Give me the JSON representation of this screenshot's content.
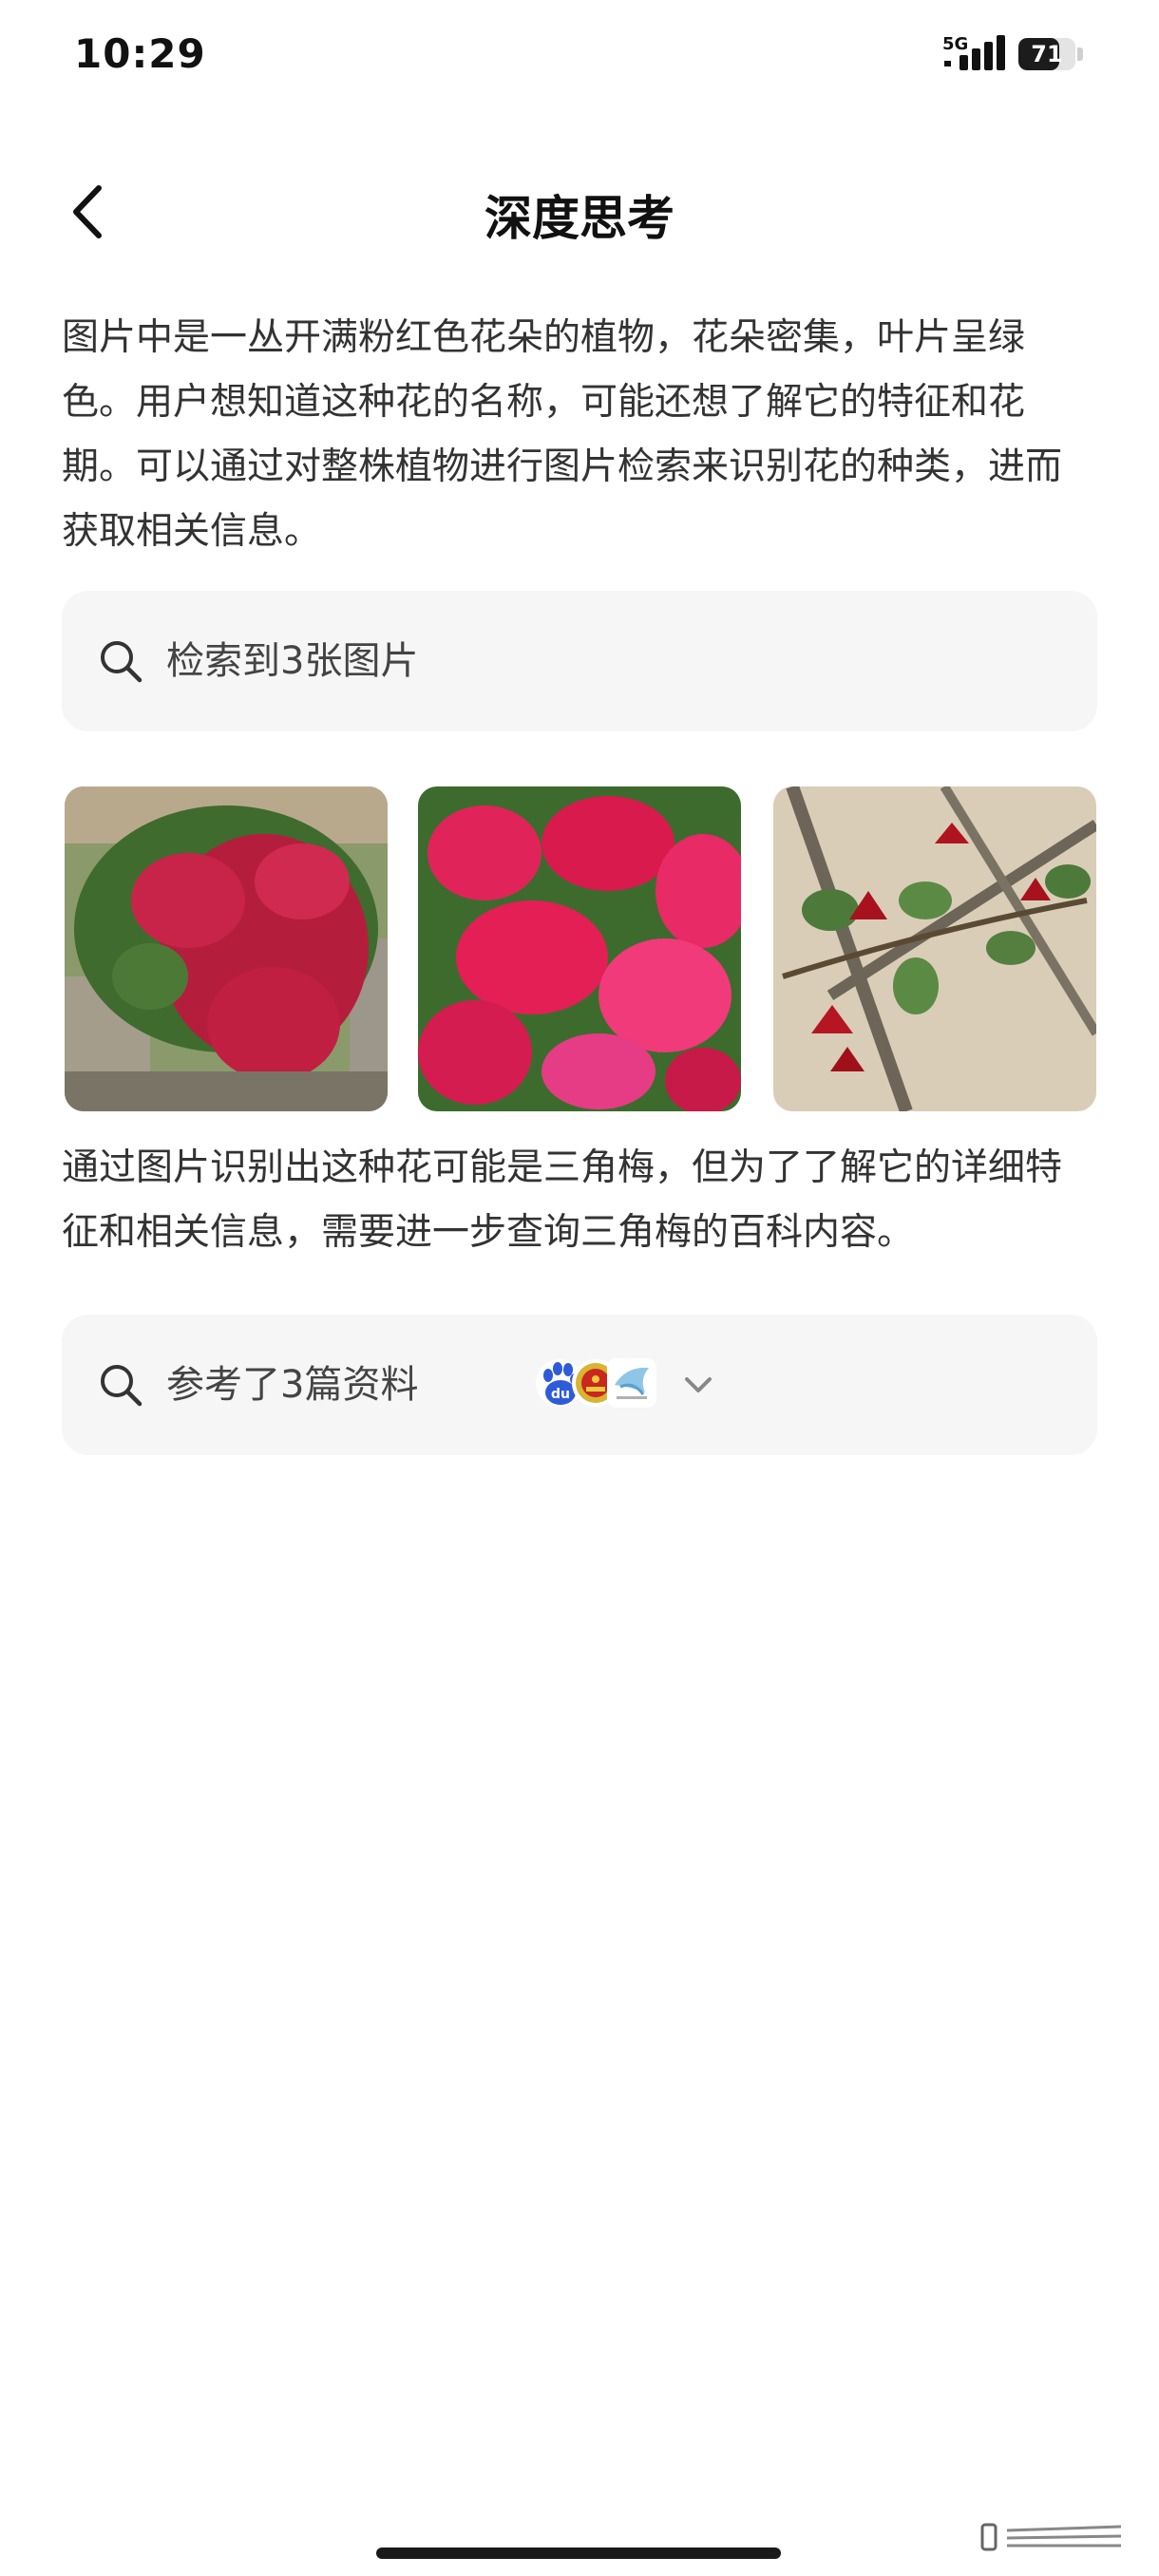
{
  "status_bar": {
    "time": "10:29",
    "network": "5G",
    "battery_level": 71,
    "battery_label": "71"
  },
  "header": {
    "title": "深度思考",
    "back_icon": "chevron-left-icon"
  },
  "thinking": {
    "paragraph1": "图片中是一丛开满粉红色花朵的植物，花朵密集，叶片呈绿色。用户想知道这种花的名称，可能还想了解它的特征和花期。可以通过对整株植物进行图片检索来识别花的种类，进而获取相关信息。",
    "image_search": {
      "icon": "search-icon",
      "label": "检索到3张图片"
    },
    "images": [
      {
        "subject": "bougainvillea bush over stone wall"
      },
      {
        "subject": "magenta bougainvillea close-up"
      },
      {
        "subject": "red bougainvillea branch"
      }
    ],
    "paragraph2": "通过图片识别出这种花可能是三角梅，但为了了解它的详细特征和相关信息，需要进一步查询三角梅的百科内容。",
    "references": {
      "icon": "search-icon",
      "label": "参考了3篇资料",
      "source_icons": [
        "baidu-paw-icon",
        "national-emblem-icon",
        "bird-logo-icon"
      ],
      "expand_icon": "chevron-down-icon"
    }
  },
  "colors": {
    "background": "#ffffff",
    "card": "#f6f6f6",
    "text": "#333333",
    "title": "#111111"
  }
}
